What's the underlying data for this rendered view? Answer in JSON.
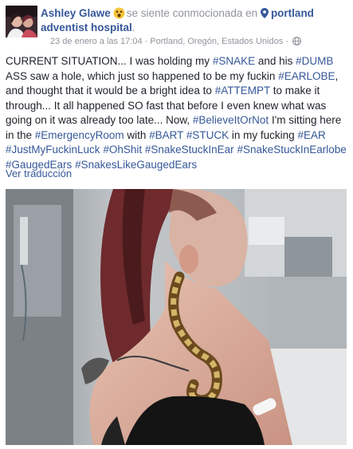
{
  "post": {
    "author": "Ashley Glawe",
    "feeling": "se siente conmocionada en",
    "place_line1": "portland",
    "place_line2": "adventist hospital",
    "place_suffix": ".",
    "date": "23 de enero a las 17:04",
    "sep1": "·",
    "location": "Portland, Oregón, Estados Unidos",
    "sep2": "·",
    "audience_icon": "globe-icon",
    "feeling_icon": "shocked-face-emoji",
    "place_icon": "location-pin-icon",
    "body": [
      {
        "t": "text",
        "v": "CURRENT SITUATION... I was holding my "
      },
      {
        "t": "tag",
        "v": "#SNAKE"
      },
      {
        "t": "text",
        "v": " and his "
      },
      {
        "t": "tag",
        "v": "#DUMB"
      },
      {
        "t": "text",
        "v": " ASS saw a hole, which just so happened to be my fuckin "
      },
      {
        "t": "tag",
        "v": "#EARLOBE"
      },
      {
        "t": "text",
        "v": ", and thought that it would be a bright idea to "
      },
      {
        "t": "tag",
        "v": "#ATTEMPT"
      },
      {
        "t": "text",
        "v": " to make it through... It all happened SO fast that before I even knew what was going on it was already too late... Now, "
      },
      {
        "t": "tag",
        "v": "#BelieveItOrNot"
      },
      {
        "t": "text",
        "v": " I'm sitting here in the "
      },
      {
        "t": "tag",
        "v": "#EmergencyRoom"
      },
      {
        "t": "text",
        "v": " with "
      },
      {
        "t": "tag",
        "v": "#BART"
      },
      {
        "t": "text",
        "v": " "
      },
      {
        "t": "tag",
        "v": "#STUCK"
      },
      {
        "t": "text",
        "v": " in my fucking "
      },
      {
        "t": "tag",
        "v": "#EAR"
      },
      {
        "t": "text",
        "v": " "
      },
      {
        "t": "tag",
        "v": "#JustMyFuckinLuck"
      },
      {
        "t": "text",
        "v": " "
      },
      {
        "t": "tag",
        "v": "#OhShit"
      },
      {
        "t": "text",
        "v": " "
      },
      {
        "t": "tag",
        "v": "#SnakeStuckInEar"
      },
      {
        "t": "text",
        "v": " "
      },
      {
        "t": "tag",
        "v": "#SnakeStuckInEarlobe"
      },
      {
        "t": "text",
        "v": " "
      },
      {
        "t": "tag",
        "v": "#GaugedEars"
      },
      {
        "t": "text",
        "v": " "
      },
      {
        "t": "tag",
        "v": "#SnakesLikeGaugedEars"
      }
    ],
    "translate_link": "Ver traducción"
  },
  "colors": {
    "link": "#365899",
    "text": "#1d2129",
    "meta": "#90949c",
    "background": "#ffffff"
  }
}
